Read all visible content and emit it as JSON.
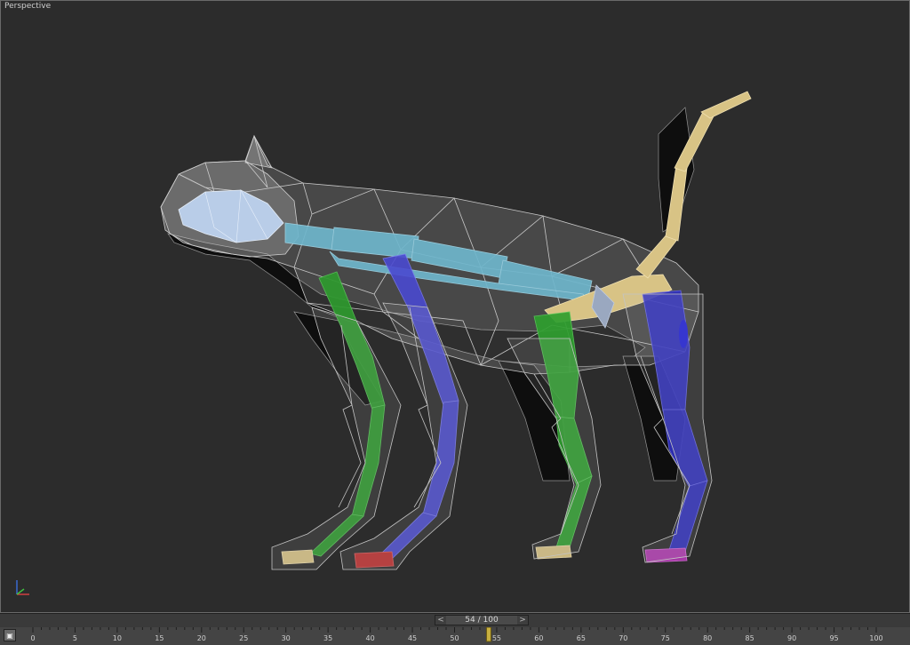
{
  "viewport": {
    "label": "Perspective"
  },
  "timeline": {
    "frame_readout": "54 / 100",
    "prev_arrow": "<",
    "next_arrow": ">",
    "current_frame": 54,
    "start": 0,
    "end": 100,
    "tick_labels": [
      "0",
      "5",
      "10",
      "15",
      "20",
      "25",
      "30",
      "35",
      "40",
      "45",
      "50",
      "55",
      "60",
      "65",
      "70",
      "75",
      "80",
      "85",
      "90",
      "95",
      "100"
    ]
  },
  "icons": {
    "time_config": "time-config-icon",
    "axis_tripod": "axis-tripod-icon"
  },
  "colors": {
    "spine": "#6fb6cc",
    "front_left_leg": "#2e9a2e",
    "rear_left_leg": "#2f9f2f",
    "front_right_leg": "#4a4ad0",
    "rear_right_leg": "#3030c0",
    "pelvis_tail": "#d8c385",
    "head": "#b9cde8",
    "wire": "#bdbdbd",
    "background": "#2c2c2c"
  }
}
